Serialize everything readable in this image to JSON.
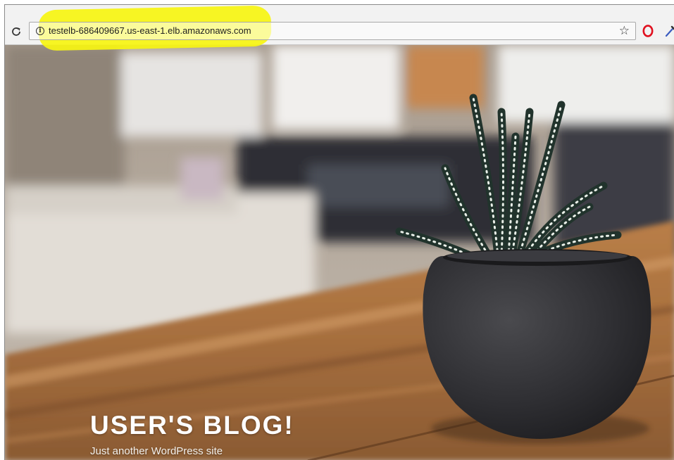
{
  "browser": {
    "url": "testelb-686409667.us-east-1.elb.amazonaws.com",
    "icons": {
      "reload": "reload-icon",
      "site_info": "info-icon",
      "bookmark": "star-icon",
      "extension_1": "opera-icon",
      "extension_2": "eyedropper-icon"
    },
    "highlight_color": "#f7f511"
  },
  "site": {
    "title": "USER'S BLOG!",
    "tagline": "Just another WordPress site"
  }
}
